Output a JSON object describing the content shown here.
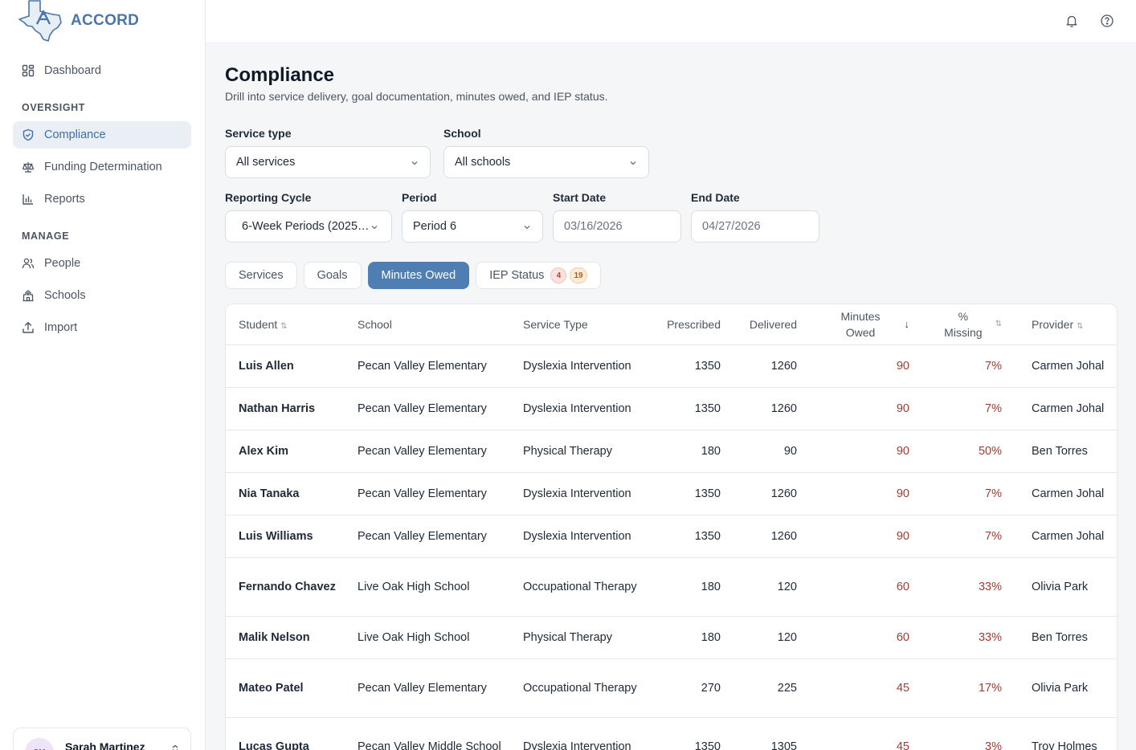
{
  "app": {
    "name": "ACCORD"
  },
  "sidebar": {
    "items_top": [
      {
        "label": "Dashboard",
        "icon": "dashboard-icon"
      }
    ],
    "section_oversight": "OVERSIGHT",
    "items_oversight": [
      {
        "label": "Compliance",
        "icon": "shield-icon",
        "active": true
      },
      {
        "label": "Funding Determination",
        "icon": "scale-icon"
      },
      {
        "label": "Reports",
        "icon": "bar-chart-icon"
      }
    ],
    "section_manage": "MANAGE",
    "items_manage": [
      {
        "label": "People",
        "icon": "users-icon"
      },
      {
        "label": "Schools",
        "icon": "school-icon"
      },
      {
        "label": "Import",
        "icon": "upload-icon"
      }
    ],
    "user": {
      "initials": "SM",
      "name": "Sarah Martinez"
    }
  },
  "page": {
    "title": "Compliance",
    "subtitle": "Drill into service delivery, goal documentation, minutes owed, and IEP status."
  },
  "filters": {
    "service_type": {
      "label": "Service type",
      "value": "All services"
    },
    "school": {
      "label": "School",
      "value": "All schools"
    },
    "reporting_cycle": {
      "label": "Reporting Cycle",
      "value": "6-Week Periods (2025-2026)"
    },
    "period": {
      "label": "Period",
      "value": "Period 6"
    },
    "start_date": {
      "label": "Start Date",
      "value": "03/16/2026"
    },
    "end_date": {
      "label": "End Date",
      "value": "04/27/2026"
    }
  },
  "tabs": [
    {
      "label": "Services"
    },
    {
      "label": "Goals"
    },
    {
      "label": "Minutes Owed",
      "active": true
    },
    {
      "label": "IEP Status",
      "badge_red": "4",
      "badge_orange": "19"
    }
  ],
  "table": {
    "columns": {
      "student": "Student",
      "school": "School",
      "service_type": "Service Type",
      "prescribed": "Prescribed",
      "delivered": "Delivered",
      "minutes_owed_1": "Minutes",
      "minutes_owed_2": "Owed",
      "pct_missing_1": "%",
      "pct_missing_2": "Missing",
      "provider": "Provider"
    },
    "rows": [
      {
        "student": "Luis Allen",
        "school": "Pecan Valley Elementary",
        "service": "Dyslexia Intervention",
        "prescribed": "1350",
        "delivered": "1260",
        "owed": "90",
        "pct": "7%",
        "provider": "Carmen Johal"
      },
      {
        "student": "Nathan Harris",
        "school": "Pecan Valley Elementary",
        "service": "Dyslexia Intervention",
        "prescribed": "1350",
        "delivered": "1260",
        "owed": "90",
        "pct": "7%",
        "provider": "Carmen Johal"
      },
      {
        "student": "Alex Kim",
        "school": "Pecan Valley Elementary",
        "service": "Physical Therapy",
        "prescribed": "180",
        "delivered": "90",
        "owed": "90",
        "pct": "50%",
        "provider": "Ben Torres"
      },
      {
        "student": "Nia Tanaka",
        "school": "Pecan Valley Elementary",
        "service": "Dyslexia Intervention",
        "prescribed": "1350",
        "delivered": "1260",
        "owed": "90",
        "pct": "7%",
        "provider": "Carmen Johal"
      },
      {
        "student": "Luis Williams",
        "school": "Pecan Valley Elementary",
        "service": "Dyslexia Intervention",
        "prescribed": "1350",
        "delivered": "1260",
        "owed": "90",
        "pct": "7%",
        "provider": "Carmen Johal"
      },
      {
        "student": "Fernando Chavez",
        "school": "Live Oak High School",
        "service": "Occupational Therapy",
        "prescribed": "180",
        "delivered": "120",
        "owed": "60",
        "pct": "33%",
        "provider": "Olivia Park"
      },
      {
        "student": "Malik Nelson",
        "school": "Live Oak High School",
        "service": "Physical Therapy",
        "prescribed": "180",
        "delivered": "120",
        "owed": "60",
        "pct": "33%",
        "provider": "Ben Torres"
      },
      {
        "student": "Mateo Patel",
        "school": "Pecan Valley Elementary",
        "service": "Occupational Therapy",
        "prescribed": "270",
        "delivered": "225",
        "owed": "45",
        "pct": "17%",
        "provider": "Olivia Park"
      },
      {
        "student": "Lucas Gupta",
        "school": "Pecan Valley Middle School",
        "service": "Dyslexia Intervention",
        "prescribed": "1350",
        "delivered": "1305",
        "owed": "45",
        "pct": "3%",
        "provider": "Troy Holmes"
      }
    ]
  },
  "colors": {
    "accent": "#4f7eb3",
    "owed_text": "#a23b32",
    "active_nav_bg": "#eaeff6"
  }
}
